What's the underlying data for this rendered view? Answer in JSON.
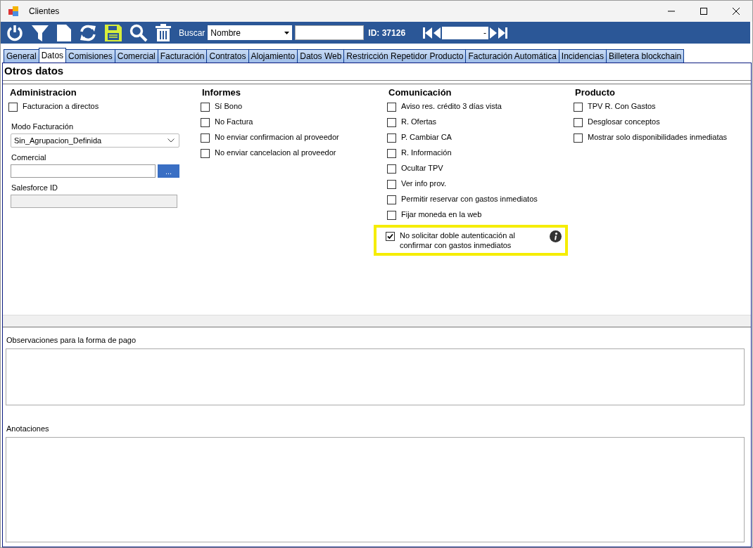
{
  "window": {
    "title": "Clientes"
  },
  "toolbar": {
    "search_label": "Buscar",
    "search_field": {
      "value": "Nombre"
    },
    "id_label": "ID: 37126",
    "record_field": {
      "value": "-"
    }
  },
  "tabs": [
    {
      "label": "General",
      "selected": false
    },
    {
      "label": "Datos",
      "selected": true
    },
    {
      "label": "Comisiones",
      "selected": false
    },
    {
      "label": "Comercial",
      "selected": false
    },
    {
      "label": "Facturación",
      "selected": false
    },
    {
      "label": "Contratos",
      "selected": false
    },
    {
      "label": "Alojamiento",
      "selected": false
    },
    {
      "label": "Datos Web",
      "selected": false
    },
    {
      "label": "Restricción Repetidor Producto",
      "selected": false
    },
    {
      "label": "Facturación Automática",
      "selected": false
    },
    {
      "label": "Incidencias",
      "selected": false
    },
    {
      "label": "Billetera blockchain",
      "selected": false
    }
  ],
  "section_title": "Otros datos",
  "columns": [
    {
      "title": "Administracion",
      "items": [
        {
          "kind": "checkbox",
          "label": "Facturacion a directos",
          "checked": false
        },
        {
          "kind": "dropdown",
          "label": "Modo Facturación",
          "value": "Sin_Agrupacion_Definida"
        },
        {
          "kind": "lookup",
          "label": "Comercial",
          "button": "..."
        },
        {
          "kind": "readonly",
          "label": "Salesforce ID"
        }
      ]
    },
    {
      "title": "Informes",
      "items": [
        {
          "kind": "checkbox",
          "label": "Sí Bono",
          "checked": false
        },
        {
          "kind": "checkbox",
          "label": "No Factura",
          "checked": false
        },
        {
          "kind": "checkbox",
          "label": "No enviar confirmacion al proveedor",
          "checked": false
        },
        {
          "kind": "checkbox",
          "label": "No enviar cancelacion al proveedor",
          "checked": false
        }
      ]
    },
    {
      "title": "Comunicación",
      "items": [
        {
          "kind": "checkbox",
          "label": "Aviso res. crédito 3 días vista",
          "checked": false
        },
        {
          "kind": "checkbox",
          "label": "R. Ofertas",
          "checked": false
        },
        {
          "kind": "checkbox",
          "label": "P. Cambiar CA",
          "checked": false
        },
        {
          "kind": "checkbox",
          "label": "R. Información",
          "checked": false
        },
        {
          "kind": "checkbox",
          "label": "Ocultar TPV",
          "checked": false
        },
        {
          "kind": "checkbox",
          "label": "Ver info prov.",
          "checked": false
        },
        {
          "kind": "checkbox",
          "label": "Permitir reservar con gastos inmediatos",
          "checked": false
        },
        {
          "kind": "checkbox",
          "label": "Fijar moneda en la web",
          "checked": false
        },
        {
          "kind": "checkbox",
          "label": "No solicitar doble autenticación al confirmar con gastos inmediatos",
          "checked": true,
          "highlighted": true,
          "info": true
        }
      ]
    },
    {
      "title": "Producto",
      "items": [
        {
          "kind": "checkbox",
          "label": "TPV R. Con Gastos",
          "checked": false
        },
        {
          "kind": "checkbox",
          "label": "Desglosar conceptos",
          "checked": false
        },
        {
          "kind": "checkbox",
          "label": "Mostrar solo disponibilidades inmediatas",
          "checked": false
        }
      ]
    }
  ],
  "observaciones": {
    "label": "Observaciones para la forma de pago"
  },
  "anotaciones": {
    "label": "Anotaciones"
  }
}
